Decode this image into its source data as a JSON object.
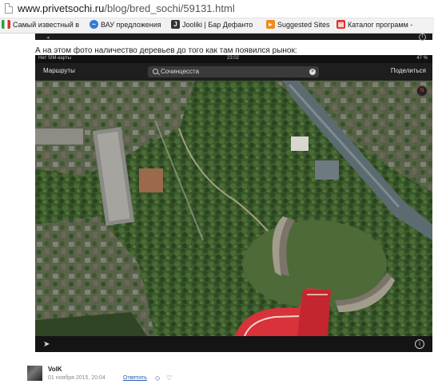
{
  "browser": {
    "url_host": "www.privetsochi.ru",
    "url_path": "/blog/bred_sochi/59131.html"
  },
  "bookmarks": [
    {
      "label": "Самый известный в",
      "icon": "italy-flag-icon",
      "color": "#2e9e3e"
    },
    {
      "label": "ВАУ предложения",
      "icon": "wave-icon",
      "color": "#2f7bd8"
    },
    {
      "label": "Jooliki | Бар Дефанто",
      "icon": "j-icon",
      "color": "#333333"
    },
    {
      "label": "Suggested Sites",
      "icon": "suggested-sites-icon",
      "color": "#f08a1c"
    },
    {
      "label": "Каталог программ -",
      "icon": "catalog-icon",
      "color": "#d9342b"
    }
  ],
  "post": {
    "caption": "А на этом фото наличество деревьев до того как там появился рынок:"
  },
  "phone": {
    "status_left": "Нет SIM-карты",
    "status_time": "23:02",
    "status_right": "47 %",
    "nav_left": "Маршруты",
    "search_text": "Сочинцесста",
    "nav_right": "Поделиться",
    "compass_label": "N"
  },
  "comment": {
    "author": "VolK",
    "date": "01 ноября 2015, 20:04",
    "reply": "Ответить"
  },
  "colors": {
    "link": "#2a5db0",
    "roof_red": "#d8323a"
  }
}
